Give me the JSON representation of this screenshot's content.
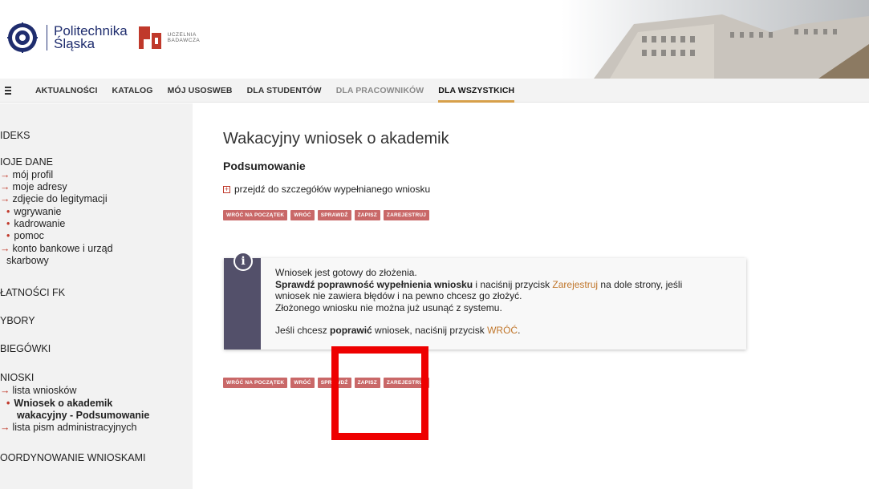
{
  "header": {
    "logo_line1": "Politechnika",
    "logo_line2": "Śląska",
    "badge_line1": "UCZELNIA",
    "badge_line2": "BADAWCZA"
  },
  "nav": {
    "items": [
      {
        "label": "AKTUALNOŚCI"
      },
      {
        "label": "KATALOG"
      },
      {
        "label": "MÓJ USOSWEB"
      },
      {
        "label": "DLA STUDENTÓW"
      },
      {
        "label": "DLA PRACOWNIKÓW"
      },
      {
        "label": "DLA WSZYSTKICH"
      }
    ]
  },
  "sidebar": {
    "indeks": "IDEKS",
    "moje_dane": "IOJE DANE",
    "moj_profil": "mój profil",
    "moje_adresy": "moje adresy",
    "zdjecie": "zdjęcie do legitymacji",
    "wgrywanie": "wgrywanie",
    "kadrowanie": "kadrowanie",
    "pomoc": "pomoc",
    "konto_1": "konto bankowe i urząd",
    "konto_2": "skarbowy",
    "platnosci": "ŁATNOŚCI FK",
    "wybory": "YBORY",
    "obiegowki": "BIEGÓWKI",
    "wnioski": "NIOSKI",
    "lista_wnioskow": "lista wniosków",
    "wniosek_1": "Wniosek o akademik",
    "wniosek_2": "wakacyjny - Podsumowanie",
    "lista_pism": "lista pism administracyjnych",
    "koordynowanie": "OORDYNOWANIE WNIOSKAMI"
  },
  "main": {
    "title": "Wakacyjny wniosek o akademik",
    "subtitle": "Podsumowanie",
    "details_link": "przejdź do szczegółów wypełnianego wniosku",
    "buttons_top": {
      "start": "WRÓĆ NA POCZĄTEK",
      "back": "WRÓĆ",
      "check": "SPRAWDŹ",
      "save": "ZAPISZ",
      "register": "ZAREJESTRUJ"
    },
    "buttons_bottom": {
      "start": "WRÓĆ NA POCZĄTEK",
      "back": "WRÓĆ",
      "check": "SPRAWDŹ",
      "save": "ZAPISZ",
      "register": "ZAREJESTRUJ"
    }
  },
  "info": {
    "icon": "i",
    "line1": "Wniosek jest gotowy do złożenia.",
    "line2_bold": "Sprawdź poprawność wypełnienia wniosku",
    "line2_mid": " i naciśnij przycisk ",
    "line2_accent": "Zarejestruj",
    "line2_end": " na dole strony, jeśli",
    "line3": "wniosek nie zawiera błędów i na pewno chcesz go złożyć.",
    "line4": "Złożonego wniosku nie można już usunąć z systemu.",
    "line5_start": "Jeśli chcesz ",
    "line5_bold": "poprawić",
    "line5_mid": " wniosek, naciśnij przycisk ",
    "line5_accent": "WRÓĆ",
    "line5_end": "."
  },
  "colors": {
    "button": "#c96868",
    "accent": "#c0762b",
    "info_strip": "#53506a",
    "highlight": "#ee0000",
    "nav_active_underline": "#d7a04a"
  }
}
